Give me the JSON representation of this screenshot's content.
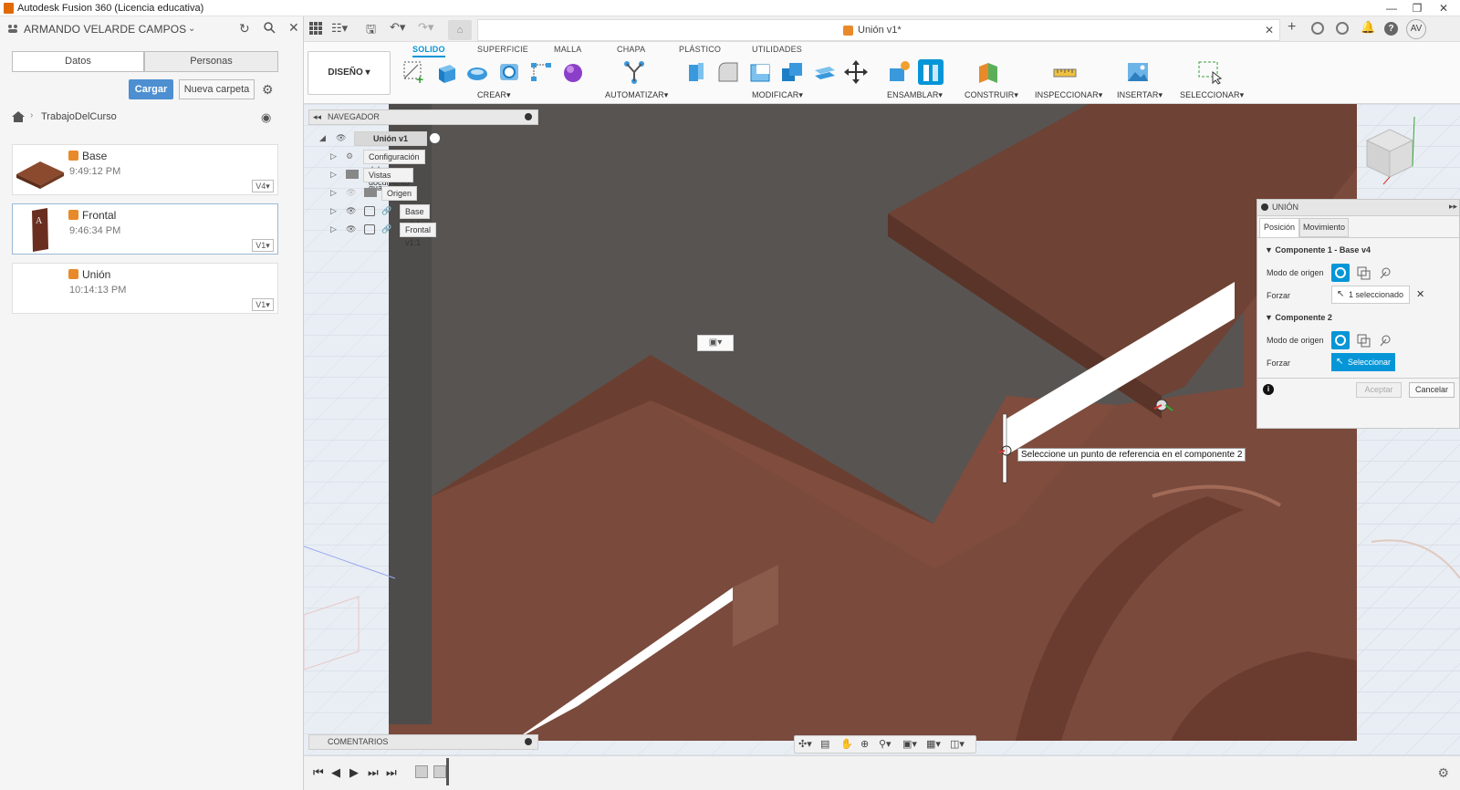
{
  "window": {
    "title": "Autodesk Fusion 360 (Licencia educativa)"
  },
  "left_panel": {
    "user": "ARMANDO VELARDE CAMPOS",
    "tabs": [
      "Datos",
      "Personas"
    ],
    "upload_label": "Cargar",
    "new_folder_label": "Nueva carpeta",
    "breadcrumb": "TrabajoDelCurso",
    "files": [
      {
        "name": "Base",
        "time": "9:49:12 PM",
        "version": "V4"
      },
      {
        "name": "Frontal",
        "time": "9:46:34 PM",
        "version": "V1"
      },
      {
        "name": "Unión",
        "time": "10:14:13 PM",
        "version": "V1"
      }
    ]
  },
  "document_tab": {
    "title": "Unión v1*"
  },
  "ribbon": {
    "workspace": "DISEÑO",
    "tabs": [
      "SOLIDO",
      "SUPERFICIE",
      "MALLA",
      "CHAPA",
      "PLÁSTICO",
      "UTILIDADES"
    ],
    "groups": [
      "CREAR",
      "AUTOMATIZAR",
      "MODIFICAR",
      "ENSAMBLAR",
      "CONSTRUIR",
      "INSPECCIONAR",
      "INSERTAR",
      "SELECCIONAR"
    ]
  },
  "navigator": {
    "title": "NAVEGADOR",
    "root": "Unión v1",
    "items": [
      "Configuración del documento",
      "Vistas guardadas",
      "Origen",
      "Base v4:1",
      "Frontal v1:1"
    ]
  },
  "comments": {
    "title": "COMENTARIOS"
  },
  "union_panel": {
    "title": "UNIÓN",
    "tabs": [
      "Posición",
      "Movimiento"
    ],
    "comp1": {
      "title": "Componente 1 - Base v4",
      "mode_label": "Modo de origen",
      "snap_label": "Forzar",
      "snap_value": "1 seleccionado"
    },
    "comp2": {
      "title": "Componente 2",
      "mode_label": "Modo de origen",
      "snap_label": "Forzar",
      "snap_value": "Seleccionar"
    },
    "ok": "Aceptar",
    "cancel": "Cancelar"
  },
  "viewport": {
    "tooltip": "Seleccione un punto de referencia en el componente 2"
  },
  "user_initials": "AV",
  "colors": {
    "accent": "#0696d7",
    "upload": "#4d8fd1",
    "model": "#7a4a3c"
  }
}
